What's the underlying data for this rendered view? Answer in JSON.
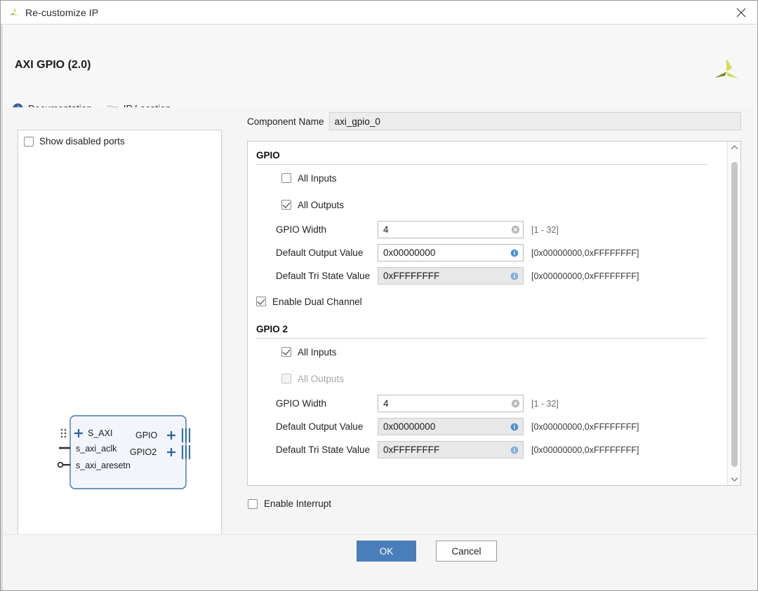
{
  "window": {
    "title": "Re-customize IP",
    "close_label": "×",
    "app_icon": "xilinx-logo-icon"
  },
  "header": {
    "title": "AXI GPIO (2.0)",
    "logo": "xilinx-logo-icon",
    "links": [
      {
        "label": "Documentation",
        "icon": "info-icon"
      },
      {
        "label": "IP Location",
        "icon": "folder-icon"
      }
    ]
  },
  "preview": {
    "show_disabled_ports": {
      "label": "Show disabled ports",
      "checked": false
    },
    "block": {
      "left_ports": [
        "S_AXI",
        "s_axi_aclk",
        "s_axi_aresetn"
      ],
      "right_ports": [
        "GPIO",
        "GPIO2"
      ]
    }
  },
  "component_name": {
    "label": "Component Name",
    "value": "axi_gpio_0"
  },
  "gpio": {
    "title": "GPIO",
    "all_inputs": {
      "label": "All Inputs",
      "checked": false,
      "disabled": false
    },
    "all_outputs": {
      "label": "All Outputs",
      "checked": true,
      "disabled": false
    },
    "width": {
      "label": "GPIO Width",
      "value": "4",
      "hint": "[1 - 32]",
      "disabled": false
    },
    "default_output": {
      "label": "Default Output Value",
      "value": "0x00000000",
      "hint": "[0x00000000,0xFFFFFFFF]",
      "disabled": false
    },
    "default_tristate": {
      "label": "Default Tri State Value",
      "value": "0xFFFFFFFF",
      "hint": "[0x00000000,0xFFFFFFFF]",
      "disabled": true
    }
  },
  "dual_channel": {
    "label": "Enable Dual Channel",
    "checked": true
  },
  "gpio2": {
    "title": "GPIO 2",
    "all_inputs": {
      "label": "All Inputs",
      "checked": true,
      "disabled": false
    },
    "all_outputs": {
      "label": "All Outputs",
      "checked": false,
      "disabled": true
    },
    "width": {
      "label": "GPIO Width",
      "value": "4",
      "hint": "[1 - 32]",
      "disabled": false
    },
    "default_output": {
      "label": "Default Output Value",
      "value": "0x00000000",
      "hint": "[0x00000000,0xFFFFFFFF]",
      "disabled": true
    },
    "default_tristate": {
      "label": "Default Tri State Value",
      "value": "0xFFFFFFFF",
      "hint": "[0x00000000,0xFFFFFFFF]",
      "disabled": true
    }
  },
  "interrupt": {
    "label": "Enable Interrupt",
    "checked": false
  },
  "footer": {
    "ok_label": "OK",
    "cancel_label": "Cancel",
    "ok_color": "#4a7ebb"
  }
}
